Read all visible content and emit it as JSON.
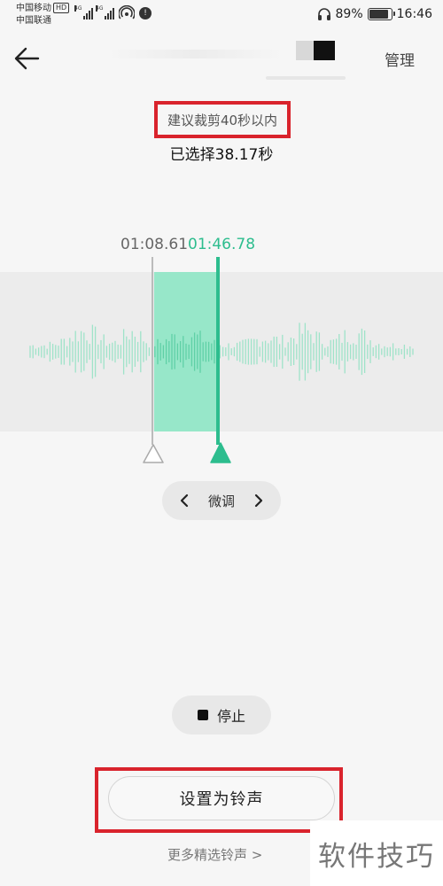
{
  "status_bar": {
    "carrier1": "中国移动",
    "carrier1_badge": "HD",
    "carrier2": "中国联通",
    "signal1_tag": "4G",
    "signal2_tag": "4G",
    "battery_percent": "89%",
    "battery_level": 0.89,
    "time": "16:46"
  },
  "top_bar": {
    "back_icon": "arrow-left-icon",
    "manage_label": "管理"
  },
  "hint": "建议裁剪40秒以内",
  "selected": "已选择38.17秒",
  "times": {
    "start": "01:08.61",
    "end": "01:46.78"
  },
  "fine_tune": {
    "label": "微调",
    "prev_icon": "chevron-left-icon",
    "next_icon": "chevron-right-icon"
  },
  "stop": {
    "label": "停止",
    "icon": "stop-icon"
  },
  "set_ringtone": "设置为铃声",
  "more_link": "更多精选铃声 >",
  "watermark": "软件技巧",
  "colors": {
    "accent": "#2dbd8e",
    "highlight": "#d9232c",
    "selection": "#88e6c3"
  }
}
